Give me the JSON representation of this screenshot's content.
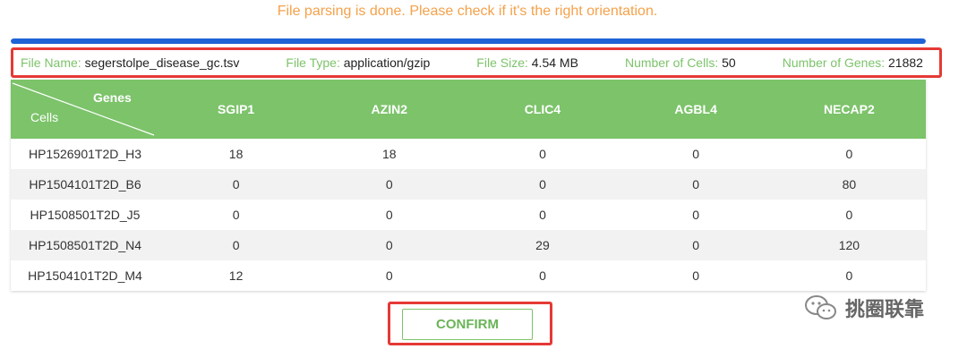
{
  "status": {
    "message": "File parsing is done. Please check if it's the right orientation."
  },
  "progress": {
    "percent": 100,
    "color": "#1e63d6"
  },
  "file_info": {
    "file_name_label": "File Name:",
    "file_name": "segerstolpe_disease_gc.tsv",
    "file_type_label": "File Type:",
    "file_type": "application/gzip",
    "file_size_label": "File Size:",
    "file_size": "4.54 MB",
    "cells_label": "Number of Cells:",
    "cells": "50",
    "genes_label": "Number of Genes:",
    "genes": "21882"
  },
  "table": {
    "corner_genes": "Genes",
    "corner_cells": "Cells",
    "columns": [
      "SGIP1",
      "AZIN2",
      "CLIC4",
      "AGBL4",
      "NECAP2"
    ],
    "rows": [
      {
        "name": "HP1526901T2D_H3",
        "values": [
          "18",
          "18",
          "0",
          "0",
          "0"
        ]
      },
      {
        "name": "HP1504101T2D_B6",
        "values": [
          "0",
          "0",
          "0",
          "0",
          "80"
        ]
      },
      {
        "name": "HP1508501T2D_J5",
        "values": [
          "0",
          "0",
          "0",
          "0",
          "0"
        ]
      },
      {
        "name": "HP1508501T2D_N4",
        "values": [
          "0",
          "0",
          "29",
          "0",
          "120"
        ]
      },
      {
        "name": "HP1504101T2D_M4",
        "values": [
          "12",
          "0",
          "0",
          "0",
          "0"
        ]
      }
    ]
  },
  "confirm": {
    "label": "CONFIRM"
  },
  "watermark": {
    "text": "挑圈联靠",
    "icon": "wechat-icon"
  },
  "colors": {
    "accent_green": "#7cc36a",
    "highlight_red": "#e53935",
    "status_orange": "#f5a14a"
  }
}
